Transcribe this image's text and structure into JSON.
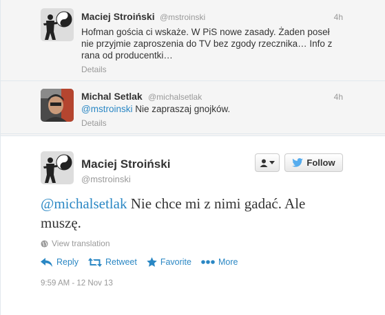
{
  "replies": [
    {
      "name": "Maciej Stroiński",
      "handle": "@mstroinski",
      "time": "4h",
      "text": "Hofman gościa ci wskaże. W PiS nowe zasady. Żaden poseł nie przyjmie zaproszenia do TV bez zgody rzecznika… Info z rana od producentki…",
      "details": "Details"
    },
    {
      "name": "Michal Setlak",
      "handle": "@michalsetlak",
      "time": "4h",
      "mention": "@mstroinski",
      "text": "Nie zapraszaj gnojków.",
      "details": "Details"
    }
  ],
  "main": {
    "name": "Maciej Stroiński",
    "handle": "@mstroinski",
    "follow_label": "Follow",
    "mention": "@michalsetlak",
    "text": "Nie chce mi z nimi gadać. Ale muszę.",
    "translate_label": "View translation",
    "actions": {
      "reply": "Reply",
      "retweet": "Retweet",
      "favorite": "Favorite",
      "more": "More"
    },
    "timestamp": "9:59 AM - 12 Nov 13"
  },
  "colors": {
    "link": "#2a87c4",
    "muted": "#999999",
    "text": "#333333",
    "bird": "#55acee"
  },
  "icons": [
    "yin-yang-avatar",
    "person-avatar",
    "user-dropdown-icon",
    "twitter-bird-icon",
    "globe-icon",
    "reply-icon",
    "retweet-icon",
    "star-icon",
    "more-dots-icon"
  ]
}
